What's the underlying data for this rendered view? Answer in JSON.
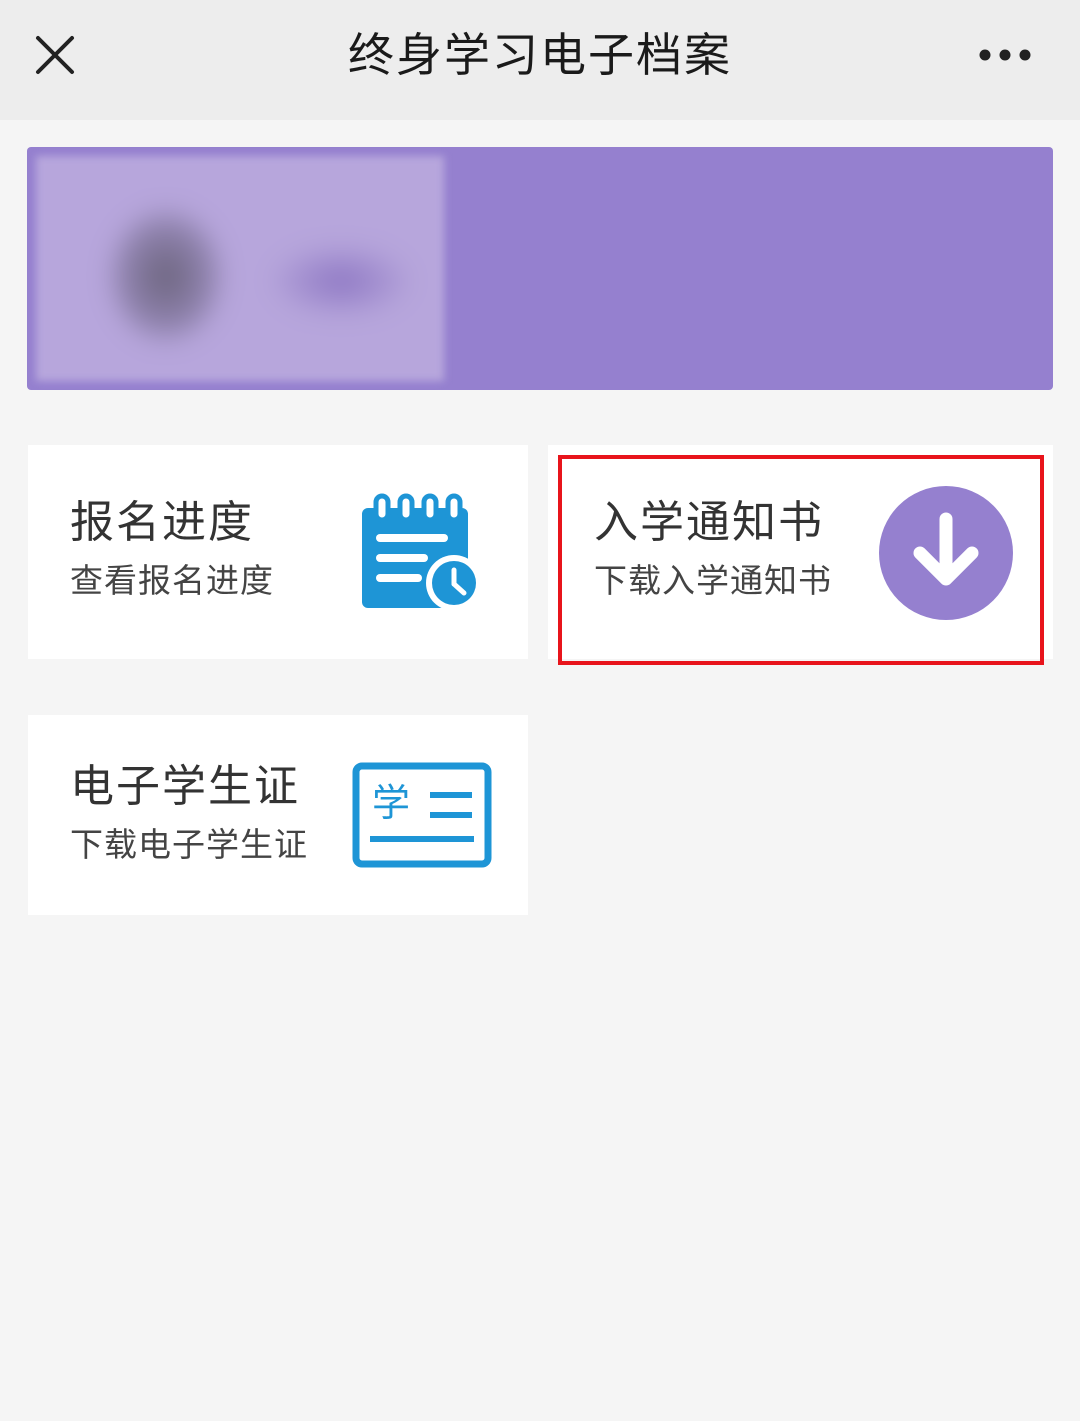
{
  "nav": {
    "title": "终身学习电子档案",
    "close_icon": "close-icon",
    "more_icon": "more-icon"
  },
  "profile": {
    "banner_color": "#9580cf"
  },
  "cards": [
    {
      "title": "报名进度",
      "subtitle": "查看报名进度",
      "icon": "notepad-clock-icon",
      "icon_color": "#1e95d6"
    },
    {
      "title": "入学通知书",
      "subtitle": "下载入学通知书",
      "icon": "download-arrow-icon",
      "icon_color": "#9580cf",
      "highlighted": true,
      "highlight_color": "#e8141b"
    },
    {
      "title": "电子学生证",
      "subtitle": "下载电子学生证",
      "icon": "student-card-icon",
      "icon_color": "#1e95d6",
      "icon_text": "学"
    }
  ]
}
